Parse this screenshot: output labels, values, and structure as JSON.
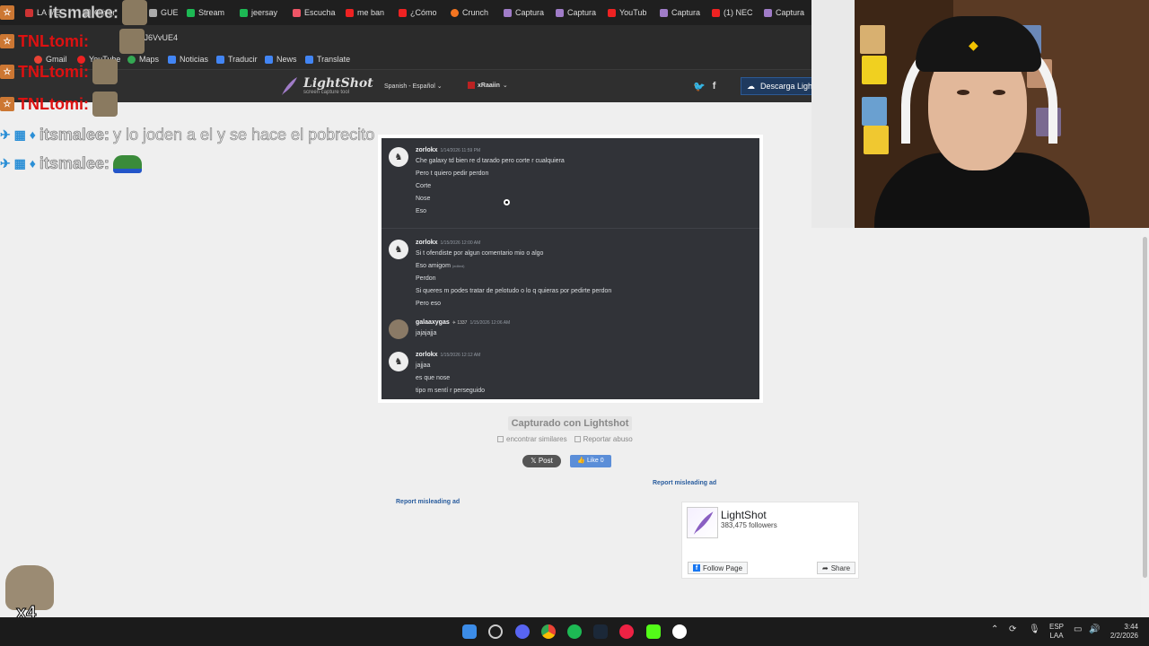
{
  "browser": {
    "tabs": [
      {
        "label": "LA ME",
        "color": "#c33"
      },
      {
        "label": "Oliver",
        "color": "#999"
      },
      {
        "label": "GUE",
        "color": "#aaa"
      },
      {
        "label": "Stream",
        "color": "#1db954"
      },
      {
        "label": "jeersay",
        "color": "#1db954"
      },
      {
        "label": "Escucha",
        "color": "#e56"
      },
      {
        "label": "me ban",
        "color": "#e22"
      },
      {
        "label": "¿Cómo",
        "color": "#e22"
      },
      {
        "label": "Crunch",
        "color": "#f47521"
      },
      {
        "label": "Captura",
        "color": "#a07cc8"
      },
      {
        "label": "Captura",
        "color": "#a07cc8"
      },
      {
        "label": "YouTub",
        "color": "#e22"
      },
      {
        "label": "Captura",
        "color": "#a07cc8"
      },
      {
        "label": "(1) NEC",
        "color": "#e22"
      },
      {
        "label": "Captura",
        "color": "#a07cc8"
      }
    ],
    "url_fragment": "Fqe1J6VvUE4",
    "bookmarks": [
      {
        "label": "Gmail",
        "color": "#ea4335"
      },
      {
        "label": "YouTube",
        "color": "#e22"
      },
      {
        "label": "Maps",
        "color": "#34a853"
      },
      {
        "label": "Noticias",
        "color": "#4285f4"
      },
      {
        "label": "Traducir",
        "color": "#4285f4"
      },
      {
        "label": "News",
        "color": "#4285f4"
      },
      {
        "label": "Translate",
        "color": "#4285f4"
      }
    ]
  },
  "lightshot": {
    "logo_title": "LightShot",
    "logo_subtitle": "screen capture tool",
    "language": "Spanish - Español",
    "username": "xRaaiin",
    "download_label": "Descarga Lightshot",
    "captured_label": "Capturado con Lightshot",
    "find_similar": "encontrar similares",
    "report_abuse": "Reportar abuso",
    "post_label": "Post",
    "like_label": "Like 0",
    "report_ad_1": "Report misleading ad",
    "report_ad_2": "Report misleading ad"
  },
  "discord": {
    "messages": [
      {
        "author": "zorlokx",
        "time": "1/14/2026 11:59 PM",
        "lines": [
          "Che galaxy td  bien re d tarado pero corte r cualquiera",
          "Pero t quiero pedir perdon",
          "Corte",
          "Nose",
          "Eso"
        ]
      },
      {
        "author": "zorlokx",
        "time": "1/15/2026 12:00 AM",
        "lines": [
          "Si t ofendiste por algun comentario mio o algo",
          "Eso amigom",
          "Perdon",
          "Si queres m podes tratar de  pelotudo o lo q quieras por pedirte perdon",
          "Pero eso"
        ],
        "edited": "(edited)"
      },
      {
        "author": "galaaxygas",
        "tag": "1337",
        "time": "1/15/2026 12:06 AM",
        "lines": [
          "jajajajja"
        ]
      },
      {
        "author": "zorlokx",
        "time": "1/15/2026 12:12 AM",
        "lines": [
          "jajjaa",
          "es que nose",
          "tipo m sentí r perseguido"
        ]
      }
    ]
  },
  "facebook": {
    "page_name": "LightShot",
    "followers": "383,475 followers",
    "follow_label": "Follow Page",
    "share_label": "Share"
  },
  "chat_overlay": [
    {
      "name": "itsmalee:",
      "text": ""
    },
    {
      "name": "TNLtomi:",
      "text": ""
    },
    {
      "name": "TNLtomi:",
      "text": ""
    },
    {
      "name": "TNLtomi:",
      "text": ""
    },
    {
      "name": "itsmalee:",
      "text": "y lo joden a el y se hace el pobrecito"
    },
    {
      "name": "itsmalee:",
      "text": ""
    }
  ],
  "seal_multiplier": "x4",
  "taskbar": {
    "language_1": "ESP",
    "language_2": "LAA",
    "time": "3:44",
    "date": "2/2/2026"
  }
}
